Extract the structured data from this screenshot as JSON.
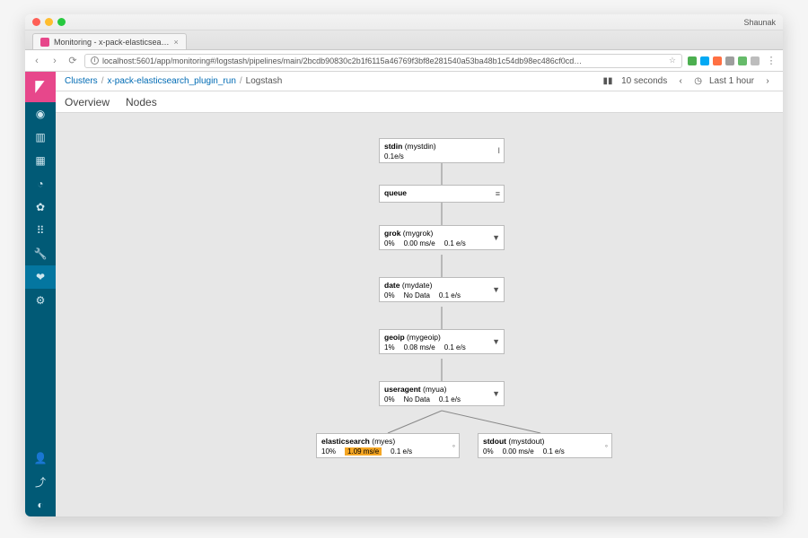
{
  "browser": {
    "user": "Shaunak",
    "tab_title": "Monitoring - x-pack-elasticsea…",
    "url": "localhost:5601/app/monitoring#/logstash/pipelines/main/2bcdb90830c2b1f6115a46769f3bf8e281540a53ba48b1c54db98ec486cf0cd…"
  },
  "header": {
    "breadcrumb": {
      "clusters": "Clusters",
      "cluster": "x-pack-elasticsearch_plugin_run",
      "page": "Logstash"
    },
    "refresh": "10 seconds",
    "timerange": "Last 1 hour"
  },
  "tabs": {
    "overview": "Overview",
    "nodes": "Nodes"
  },
  "nodes": {
    "stdin": {
      "name": "stdin",
      "sub": "(mystdin)",
      "rate": "0.1e/s",
      "icon": "I"
    },
    "queue": {
      "name": "queue",
      "icon": "≡"
    },
    "grok": {
      "name": "grok",
      "sub": "(mygrok)",
      "pct": "0%",
      "ms": "0.00 ms/e",
      "rate": "0.1 e/s",
      "icon": "▼"
    },
    "date": {
      "name": "date",
      "sub": "(mydate)",
      "pct": "0%",
      "ms": "No Data",
      "rate": "0.1 e/s",
      "icon": "▼"
    },
    "geoip": {
      "name": "geoip",
      "sub": "(mygeoip)",
      "pct": "1%",
      "ms": "0.08 ms/e",
      "rate": "0.1 e/s",
      "icon": "▼"
    },
    "ua": {
      "name": "useragent",
      "sub": "(myua)",
      "pct": "0%",
      "ms": "No Data",
      "rate": "0.1 e/s",
      "icon": "▼"
    },
    "es": {
      "name": "elasticsearch",
      "sub": "(myes)",
      "pct": "10%",
      "ms": "1.09 ms/e",
      "rate": "0.1 e/s",
      "icon": "◦"
    },
    "stdout": {
      "name": "stdout",
      "sub": "(mystdout)",
      "pct": "0%",
      "ms": "0.00 ms/e",
      "rate": "0.1 e/s",
      "icon": "◦"
    }
  }
}
